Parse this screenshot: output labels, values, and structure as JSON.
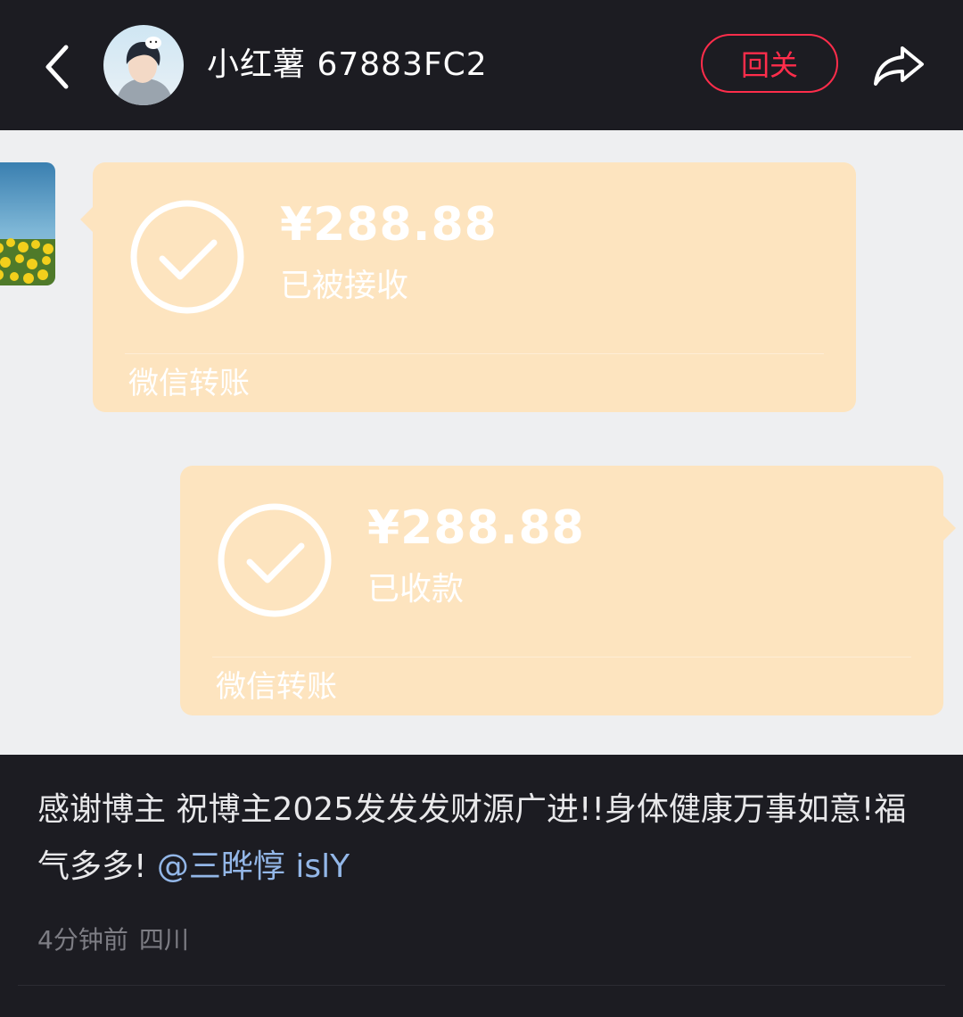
{
  "header": {
    "username": "小红薯 67883FC2",
    "follow_label": "回关",
    "icons": {
      "back": "chevron-left-icon",
      "share": "share-arrow-icon"
    },
    "accent_color": "#ff2d4b"
  },
  "image": {
    "transfers": [
      {
        "amount": "¥288.88",
        "status": "已被接收",
        "brand": "微信转账"
      },
      {
        "amount": "¥288.88",
        "status": "已收款",
        "brand": "微信转账"
      }
    ]
  },
  "comment": {
    "text": "感谢博主 祝博主2025发发发财源广进!!身体健康万事如意!福气多多!",
    "mention": "@三晔惇 islY",
    "time": "4分钟前",
    "location": "四川"
  }
}
